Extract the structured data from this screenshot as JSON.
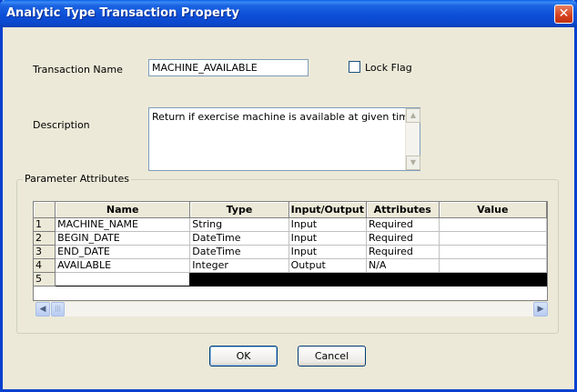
{
  "window": {
    "title": "Analytic Type Transaction Property",
    "close_symbol": "✕"
  },
  "form": {
    "transaction_name_label": "Transaction Name",
    "transaction_name_value": "MACHINE_AVAILABLE",
    "lock_flag_label": "Lock Flag",
    "lock_flag_checked": false,
    "description_label": "Description",
    "description_value": "Return if exercise machine is available at given time."
  },
  "parameters": {
    "group_label": "Parameter Attributes",
    "columns": [
      "Name",
      "Type",
      "Input/Output",
      "Attributes",
      "Value"
    ],
    "rows": [
      {
        "num": "1",
        "name": "MACHINE_NAME",
        "type": "String",
        "io": "Input",
        "attributes": "Required",
        "value": ""
      },
      {
        "num": "2",
        "name": "BEGIN_DATE",
        "type": "DateTime",
        "io": "Input",
        "attributes": "Required",
        "value": ""
      },
      {
        "num": "3",
        "name": "END_DATE",
        "type": "DateTime",
        "io": "Input",
        "attributes": "Required",
        "value": ""
      },
      {
        "num": "4",
        "name": "AVAILABLE",
        "type": "Integer",
        "io": "Output",
        "attributes": "N/A",
        "value": ""
      },
      {
        "num": "5",
        "name": "",
        "type": "",
        "io": "",
        "attributes": "",
        "value": ""
      }
    ],
    "selected_row": "5"
  },
  "buttons": {
    "ok": "OK",
    "cancel": "Cancel"
  },
  "icons": {
    "close": "close-icon",
    "scroll_up": "scroll-up-arrow-icon",
    "scroll_down": "scroll-down-arrow-icon",
    "scroll_left": "scroll-left-arrow-icon",
    "scroll_right": "scroll-right-arrow-icon"
  },
  "colors": {
    "titlebar": "#0A48CD",
    "dialog_bg": "#ECE9D8",
    "selected_row": "#000000"
  }
}
